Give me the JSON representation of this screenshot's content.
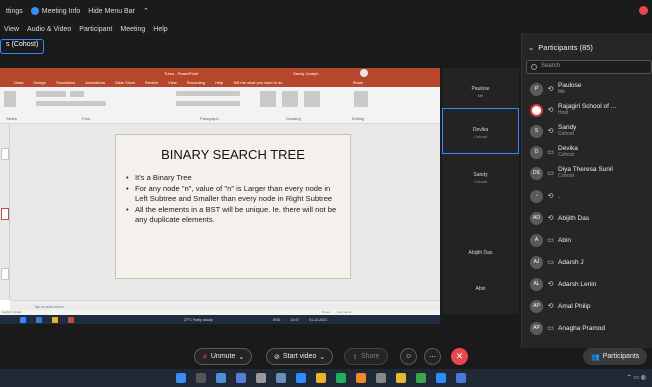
{
  "zoom_menu": {
    "items": [
      "ttings",
      "Meeting Info",
      "Hide Menu Bar"
    ],
    "submenu": [
      "View",
      "Audio & Video",
      "Participant",
      "Meeting",
      "Help"
    ],
    "role_pill": "s (Cohost)"
  },
  "powerpoint": {
    "title_bar": "Trees - PowerPoint",
    "user": "Sandy Joseph",
    "tabs": [
      "Draw",
      "Design",
      "Transitions",
      "Animations",
      "Slide Show",
      "Review",
      "View",
      "Recording",
      "Help",
      "Tell me what you want to do",
      "Share"
    ],
    "ribbon_groups": [
      "Slides",
      "Font",
      "Paragraph",
      "Drawing",
      "Editing"
    ],
    "ribbon_buttons": [
      "New Slide",
      "Shapes",
      "Arrange",
      "Quick Styles",
      "Editing"
    ],
    "notes_placeholder": "Tap to add notes",
    "status": "English (India)",
    "status_right": [
      "Notes",
      "Comments"
    ],
    "weather": "27°C Partly cloudy",
    "lang": "ENG",
    "time": "10:47",
    "date": "01-12-2021",
    "slide": {
      "title": "BINARY SEARCH TREE",
      "bullets": [
        "It's a Binary Tree",
        "For any node \"n\", value of \"n\" is Larger than every node in Left Subtree and Smaller than every node in Right Subtree",
        "All the elements in a BST will be unique. Ie. there will not be any duplicate elements."
      ]
    }
  },
  "video_tiles": [
    {
      "name": "Paulose",
      "role": "Me",
      "active": false
    },
    {
      "name": "Devika",
      "role": "Cohost",
      "active": true
    },
    {
      "name": "Sandy",
      "role": "Cohost",
      "active": false
    },
    {
      "name": "",
      "role": "",
      "active": false
    },
    {
      "name": "Abijith Das",
      "role": "",
      "active": false
    },
    {
      "name": "Abin",
      "role": "",
      "active": false
    }
  ],
  "participants": {
    "header": "Participants (85)",
    "search_placeholder": "Search",
    "list": [
      {
        "initials": "P",
        "name": "Paulose",
        "role": "Me",
        "icon": "share"
      },
      {
        "initials": "",
        "name": "Rajagiri School of ...",
        "role": "Host",
        "icon": "share"
      },
      {
        "initials": "S",
        "name": "Sandy",
        "role": "Cohost",
        "icon": "share"
      },
      {
        "initials": "D",
        "name": "Devika",
        "role": "Cohost",
        "icon": "device"
      },
      {
        "initials": "DS",
        "name": "Diya Theresa Sunil",
        "role": "Cohost",
        "icon": "device"
      },
      {
        "initials": "",
        "name": ".",
        "role": "",
        "icon": "share"
      },
      {
        "initials": "AD",
        "name": "Abijith Das",
        "role": "",
        "icon": "share"
      },
      {
        "initials": "A",
        "name": "Abin",
        "role": "",
        "icon": "device"
      },
      {
        "initials": "AJ",
        "name": "Adarsh J",
        "role": "",
        "icon": "device"
      },
      {
        "initials": "AL",
        "name": "Adarsh Lenin",
        "role": "",
        "icon": "share"
      },
      {
        "initials": "AP",
        "name": "Amal Philip",
        "role": "",
        "icon": "share"
      },
      {
        "initials": "AP",
        "name": "Anagha Pramod",
        "role": "",
        "icon": "device"
      }
    ]
  },
  "controls": {
    "unmute": "Unmute",
    "start_video": "Start video",
    "share": "Share",
    "participants": "Participants"
  },
  "colors": {
    "zoom_blue": "#2d8cff",
    "leave_red": "#e8484d",
    "ppt_accent": "#b7472a"
  }
}
